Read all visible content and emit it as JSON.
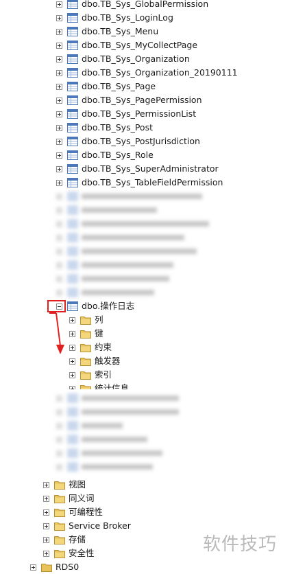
{
  "tables": [
    "dbo.TB_Sys_GlobalPermission",
    "dbo.TB_Sys_LoginLog",
    "dbo.TB_Sys_Menu",
    "dbo.TB_Sys_MyCollectPage",
    "dbo.TB_Sys_Organization",
    "dbo.TB_Sys_Organization_20190111",
    "dbo.TB_Sys_Page",
    "dbo.TB_Sys_PagePermission",
    "dbo.TB_Sys_PermissionList",
    "dbo.TB_Sys_Post",
    "dbo.TB_Sys_PostJurisdiction",
    "dbo.TB_Sys_Role",
    "dbo.TB_Sys_SuperAdministrator",
    "dbo.TB_Sys_TableFieldPermission"
  ],
  "expanded_table": {
    "label": "dbo.操作日志",
    "children": [
      "列",
      "键",
      "约束",
      "触发器",
      "索引",
      "统计信息"
    ]
  },
  "db_folders": [
    "视图",
    "同义词",
    "可编程性",
    "Service Broker",
    "存储",
    "安全性"
  ],
  "next_database": "RDS0",
  "watermark": "软件技巧",
  "colors": {
    "highlight": "#e02020",
    "folder": "#e8c25a",
    "table_icon": "#4a78b8"
  }
}
